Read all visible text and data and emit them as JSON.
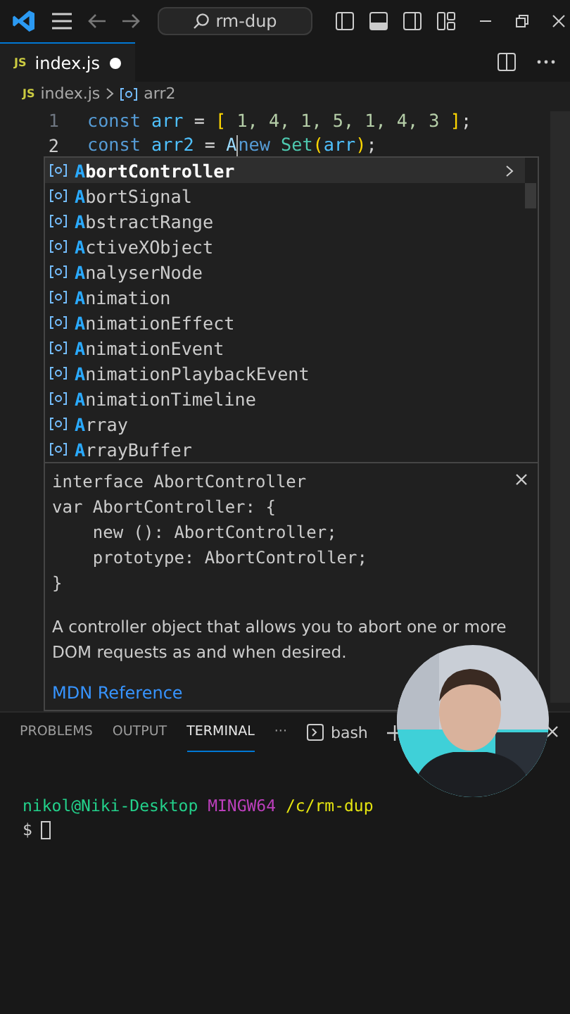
{
  "title_bar": {
    "search": "rm-dup"
  },
  "tabs": [
    {
      "badge": "JS",
      "label": "index.js",
      "modified": true,
      "selected": true
    }
  ],
  "breadcrumb": {
    "badge": "JS",
    "file": "index.js",
    "symbol": "arr2"
  },
  "code": [
    {
      "number": "1",
      "tokens": [
        {
          "kind": "keyword",
          "text": "const"
        },
        {
          "kind": "variable",
          "text": " arr"
        },
        {
          "kind": "plain",
          "text": " = "
        },
        {
          "kind": "bracket",
          "text": "["
        },
        {
          "kind": "number",
          "text": " 1, 4, 1, 5, 1, 4, 3 "
        },
        {
          "kind": "bracket",
          "text": "]"
        },
        {
          "kind": "plain",
          "text": ";"
        }
      ]
    },
    {
      "number": "2",
      "tokens": [
        {
          "kind": "keyword",
          "text": "const"
        },
        {
          "kind": "variable",
          "text": " arr2"
        },
        {
          "kind": "plain",
          "text": " = "
        },
        {
          "kind": "typed",
          "text": "A"
        },
        {
          "kind": "cursor"
        },
        {
          "kind": "keyword",
          "text": "new "
        },
        {
          "kind": "class",
          "text": "Set"
        },
        {
          "kind": "bracket",
          "text": "("
        },
        {
          "kind": "variable",
          "text": "arr"
        },
        {
          "kind": "bracket",
          "text": ")"
        },
        {
          "kind": "plain",
          "text": ";"
        }
      ]
    }
  ],
  "suggestions": [
    {
      "match": "A",
      "rest": "bortController",
      "selected": true
    },
    {
      "match": "A",
      "rest": "bortSignal",
      "selected": false
    },
    {
      "match": "A",
      "rest": "bstractRange",
      "selected": false
    },
    {
      "match": "A",
      "rest": "ctiveXObject",
      "selected": false
    },
    {
      "match": "A",
      "rest": "nalyserNode",
      "selected": false
    },
    {
      "match": "A",
      "rest": "nimation",
      "selected": false
    },
    {
      "match": "A",
      "rest": "nimationEffect",
      "selected": false
    },
    {
      "match": "A",
      "rest": "nimationEvent",
      "selected": false
    },
    {
      "match": "A",
      "rest": "nimationPlaybackEvent",
      "selected": false
    },
    {
      "match": "A",
      "rest": "nimationTimeline",
      "selected": false
    },
    {
      "match": "A",
      "rest": "rray",
      "selected": false
    },
    {
      "match": "A",
      "rest": "rrayBuffer",
      "selected": false
    }
  ],
  "details": {
    "signature": [
      "interface AbortController",
      "var AbortController: {",
      "    new (): AbortController;",
      "    prototype: AbortController;",
      "}"
    ],
    "description": "A controller object that allows you to abort one or more DOM requests as and when desired.",
    "link": "MDN Reference"
  },
  "panel": {
    "tabs": [
      {
        "label": "PROBLEMS",
        "selected": false
      },
      {
        "label": "OUTPUT",
        "selected": false
      },
      {
        "label": "TERMINAL",
        "selected": true
      }
    ],
    "more": "···",
    "terminal_name": "bash"
  },
  "terminal": {
    "user": "nikol@Niki-Desktop",
    "env": "MINGW64",
    "path": "/c/rm-dup",
    "prompt": "$"
  }
}
